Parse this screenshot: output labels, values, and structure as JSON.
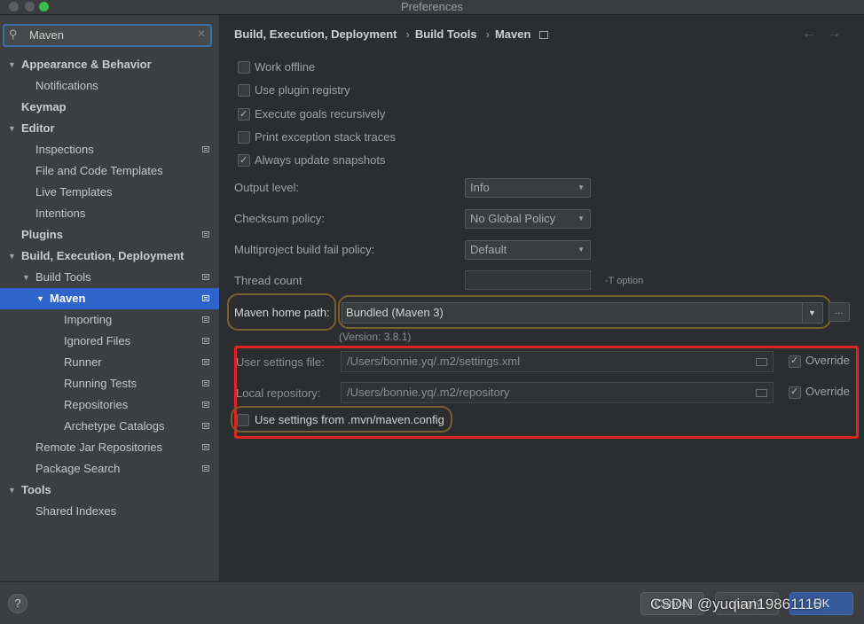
{
  "window": {
    "title": "Preferences"
  },
  "search": {
    "value": "Maven"
  },
  "sidebar": {
    "items": [
      {
        "label": "Appearance & Behavior"
      },
      {
        "label": "Notifications"
      },
      {
        "label": "Keymap"
      },
      {
        "label": "Editor"
      },
      {
        "label": "Inspections"
      },
      {
        "label": "File and Code Templates"
      },
      {
        "label": "Live Templates"
      },
      {
        "label": "Intentions"
      },
      {
        "label": "Plugins"
      },
      {
        "label": "Build, Execution, Deployment"
      },
      {
        "label": "Build Tools"
      },
      {
        "label": "Maven"
      },
      {
        "label": "Importing"
      },
      {
        "label": "Ignored Files"
      },
      {
        "label": "Runner"
      },
      {
        "label": "Running Tests"
      },
      {
        "label": "Repositories"
      },
      {
        "label": "Archetype Catalogs"
      },
      {
        "label": "Remote Jar Repositories"
      },
      {
        "label": "Package Search"
      },
      {
        "label": "Tools"
      },
      {
        "label": "Shared Indexes"
      }
    ]
  },
  "breadcrumb": {
    "part1": "Build, Execution, Deployment",
    "part2": "Build Tools",
    "part3": "Maven"
  },
  "options": {
    "work_offline": "Work offline",
    "use_plugin_registry": "Use plugin registry",
    "execute_goals_recursively": "Execute goals recursively",
    "print_exception_stack_traces": "Print exception stack traces",
    "always_update_snapshots": "Always update snapshots"
  },
  "form": {
    "output_level_label": "Output level:",
    "output_level_value": "Info",
    "checksum_policy_label": "Checksum policy:",
    "checksum_policy_value": "No Global Policy",
    "multiproject_label": "Multiproject build fail policy:",
    "multiproject_value": "Default",
    "thread_count_label": "Thread count",
    "thread_count_value": "",
    "t_option": "-T option",
    "maven_home_label": "Maven home path:",
    "maven_home_value": "Bundled (Maven 3)",
    "browse": "...",
    "version": "(Version: 3.8.1)",
    "user_settings_label": "User settings file:",
    "user_settings_value": "/Users/bonnie.yq/.m2/settings.xml",
    "local_repo_label": "Local repository:",
    "local_repo_value": "/Users/bonnie.yq/.m2/repository",
    "override": "Override",
    "use_mvn_config": "Use settings from .mvn/maven.config"
  },
  "buttons": {
    "help": "?",
    "cancel": "Cancel",
    "apply": "Apply",
    "ok": "OK"
  },
  "watermark": "CSDN @yuqian19861115",
  "colors": {
    "selection": "#2f65ca",
    "highlight_box": "#e0241f",
    "accent_outline": "#7a5f2f"
  }
}
